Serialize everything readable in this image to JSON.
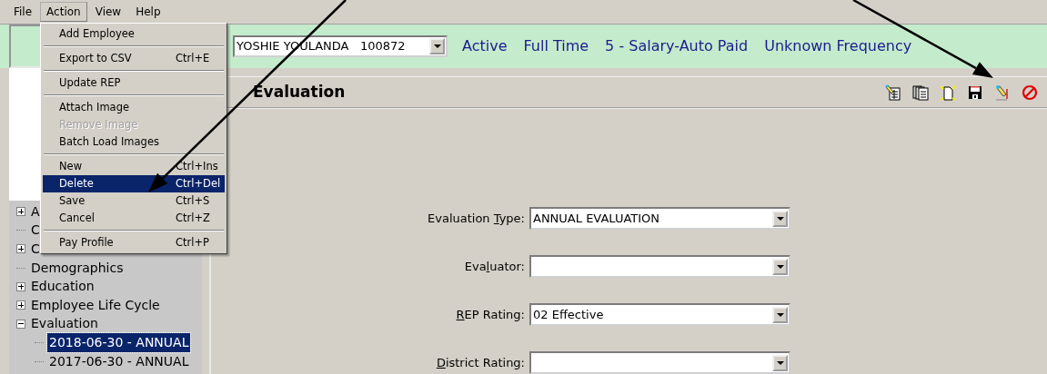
{
  "menu_bar": [
    {
      "label": "File",
      "selected": false
    },
    {
      "label": "Action",
      "selected": true
    },
    {
      "label": "View",
      "selected": false
    },
    {
      "label": "Help",
      "selected": false
    }
  ],
  "action_menu": [
    {
      "kind": "item",
      "label": "Add Employee",
      "disabled": false,
      "selected": false
    },
    {
      "kind": "separator"
    },
    {
      "kind": "item",
      "label": "Export to CSV",
      "shortcut": "Ctrl+E",
      "disabled": false,
      "selected": false
    },
    {
      "kind": "separator"
    },
    {
      "kind": "item",
      "label": "Update REP",
      "disabled": false,
      "selected": false
    },
    {
      "kind": "separator"
    },
    {
      "kind": "item",
      "label": "Attach Image",
      "disabled": false,
      "selected": false
    },
    {
      "kind": "item",
      "label": "Remove Image",
      "disabled": true,
      "selected": false
    },
    {
      "kind": "item",
      "label": "Batch Load Images",
      "disabled": false,
      "selected": false
    },
    {
      "kind": "separator"
    },
    {
      "kind": "item",
      "label": "New",
      "shortcut": "Ctrl+Ins",
      "disabled": false,
      "selected": false
    },
    {
      "kind": "item",
      "label": "Delete",
      "shortcut": "Ctrl+Del",
      "disabled": false,
      "selected": true
    },
    {
      "kind": "item",
      "label": "Save",
      "shortcut": "Ctrl+S",
      "disabled": false,
      "selected": false
    },
    {
      "kind": "item",
      "label": "Cancel",
      "shortcut": "Ctrl+Z",
      "disabled": false,
      "selected": false
    },
    {
      "kind": "separator"
    },
    {
      "kind": "item",
      "label": "Pay Profile",
      "shortcut": "Ctrl+P",
      "disabled": false,
      "selected": false
    }
  ],
  "employee": {
    "value": "YOSHIE YOULANDA   100872",
    "statuses": [
      "Active",
      "Full Time",
      "5 - Salary-Auto Paid",
      "Unknown Frequency"
    ]
  },
  "tree": [
    {
      "label": "A",
      "kind": "folder",
      "expanded": false,
      "selected": false
    },
    {
      "label": "C",
      "kind": "leaf",
      "selected": false
    },
    {
      "label": "C",
      "kind": "folder",
      "expanded": false,
      "selected": false
    },
    {
      "label": "Demographics",
      "kind": "leaf",
      "selected": false
    },
    {
      "label": "Education",
      "kind": "folder",
      "expanded": false,
      "selected": false
    },
    {
      "label": "Employee Life Cycle",
      "kind": "folder",
      "expanded": false,
      "selected": false
    },
    {
      "label": "Evaluation",
      "kind": "folder",
      "expanded": true,
      "selected": false,
      "children": [
        {
          "label": "2018-06-30 - ANNUAL",
          "kind": "leaf",
          "selected": true
        },
        {
          "label": "2017-06-30 - ANNUAL",
          "kind": "leaf",
          "selected": false
        }
      ]
    }
  ],
  "section": {
    "title": "Evaluation",
    "toolbar": [
      {
        "kind": "edit-page"
      },
      {
        "kind": "pages"
      },
      {
        "kind": "new-page"
      },
      {
        "kind": "save"
      },
      {
        "kind": "pencil"
      },
      {
        "kind": "cancel"
      }
    ]
  },
  "form": [
    {
      "label_parts": [
        {
          "text": "Evaluation ",
          "underline": false
        },
        {
          "text": "T",
          "underline": true
        },
        {
          "text": "ype:",
          "underline": false
        }
      ],
      "value": "ANNUAL EVALUATION"
    },
    {
      "label_parts": [
        {
          "text": "Eva",
          "underline": false
        },
        {
          "text": "l",
          "underline": true
        },
        {
          "text": "uator:",
          "underline": false
        }
      ]
    },
    {
      "label_parts": [
        {
          "text": "R",
          "underline": true
        },
        {
          "text": "EP Rating:",
          "underline": false
        }
      ],
      "value": "02 Effective"
    },
    {
      "label_parts": [
        {
          "text": "D",
          "underline": true
        },
        {
          "text": "istrict Rating:",
          "underline": false
        }
      ]
    }
  ],
  "annotations": [
    {
      "kind": "arrow"
    },
    {
      "kind": "arrow"
    }
  ]
}
